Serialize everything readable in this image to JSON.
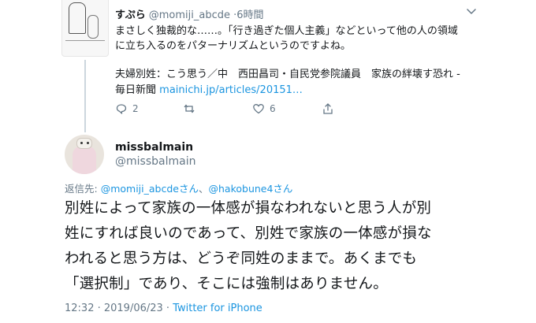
{
  "parent_tweet": {
    "name": "すぷら",
    "handle": "@momiji_abcde",
    "separator": "·",
    "time": "6時間",
    "text_line1": "まさしく独裁的な……。「行き過ぎた個人主義」などといって他の人の領域",
    "text_line2": "に立ち入るのをパターナリズムというのですよね。",
    "link_title": "夫婦別姓：こう思う／中　西田昌司・自民党参院議員　家族の絆壊す恐れ -",
    "link_source": "毎日新聞",
    "link_url": "mainichi.jp/articles/20151…",
    "reply_count": "2",
    "retweet_count": "",
    "like_count": "6"
  },
  "main_tweet": {
    "name": "missbalmain",
    "handle": "@missbalmain",
    "reply_label": "返信先:",
    "reply_mention1": "@momiji_abcdeさん",
    "reply_sep": "、",
    "reply_mention2": "@hakobune4さん",
    "text_line1": "別姓によって家族の一体感が損なわれないと思う人が別",
    "text_line2": "姓にすれば良いのであって、別姓で家族の一体感が損な",
    "text_line3": "われると思う方は、どうぞ同姓のままで。あくまでも",
    "text_line4": "「選択制」であり、そこには強制はありません。",
    "timestamp": "12:32 · 2019/06/23 · ",
    "source": "Twitter for iPhone"
  },
  "colors": {
    "text": "#14171a",
    "secondary": "#657786",
    "link": "#1b95e0",
    "thread_line": "#ccd6dd"
  }
}
